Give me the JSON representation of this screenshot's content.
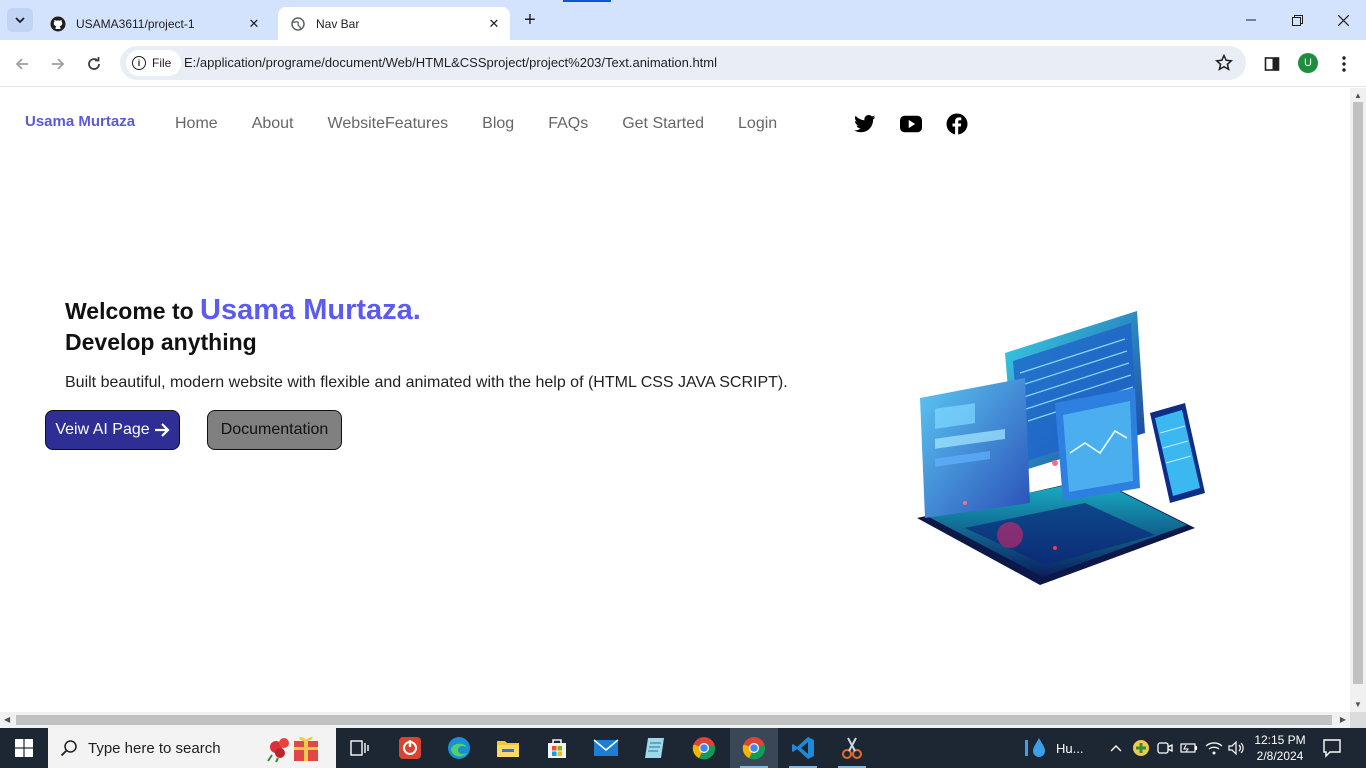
{
  "browser": {
    "tabs": [
      {
        "title": "USAMA3611/project-1",
        "favicon": "github-icon",
        "active": false
      },
      {
        "title": "Nav Bar",
        "favicon": "globe-icon",
        "active": true
      }
    ],
    "site_chip": "File",
    "url": "E:/application/programe/document/Web/HTML&CSSproject/project%203/Text.animation.html",
    "profile_initial": "U"
  },
  "page": {
    "brand": "Usama Murtaza",
    "nav": [
      "Home",
      "About",
      "WebsiteFeatures",
      "Blog",
      "FAQs",
      "Get Started",
      "Login"
    ],
    "socials": [
      "twitter-icon",
      "youtube-icon",
      "facebook-icon"
    ],
    "hero": {
      "welcome": "Welcome to",
      "name": "Usama Murtaza.",
      "subtitle": "Develop anything",
      "description": "Built beautiful, modern website with flexible and animated with the help of (HTML CSS JAVA SCRIPT).",
      "primary_button": "Veiw AI Page",
      "secondary_button": "Documentation"
    },
    "accent_color": "#5b5bf0",
    "primary_button_color": "#2e2e95"
  },
  "taskbar": {
    "search_placeholder": "Type here to search",
    "weather": "Hu...",
    "time": "12:15 PM",
    "date": "2/8/2024"
  }
}
